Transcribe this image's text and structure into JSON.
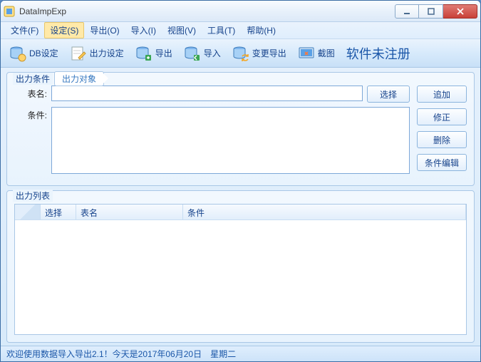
{
  "window": {
    "title": "DataImpExp"
  },
  "menu": {
    "items": [
      {
        "label": "文件(F)"
      },
      {
        "label": "设定(S)",
        "active": true
      },
      {
        "label": "导出(O)"
      },
      {
        "label": "导入(I)"
      },
      {
        "label": "视图(V)"
      },
      {
        "label": "工具(T)"
      },
      {
        "label": "帮助(H)"
      }
    ]
  },
  "toolbar": {
    "items": [
      {
        "label": "DB设定",
        "icon": "db-gear"
      },
      {
        "label": "出力设定",
        "icon": "sheet-pencil"
      },
      {
        "label": "导出",
        "icon": "db-export"
      },
      {
        "label": "导入",
        "icon": "db-import"
      },
      {
        "label": "变更导出",
        "icon": "db-change"
      },
      {
        "label": "截图",
        "icon": "screenshot"
      }
    ],
    "unregistered": "软件未注册"
  },
  "group1": {
    "title": "出力条件",
    "tab": "出力对象",
    "table_label": "表名:",
    "table_value": "",
    "cond_label": "条件:",
    "cond_value": "",
    "select_btn": "选择",
    "add_btn": "追加",
    "edit_btn": "修正",
    "delete_btn": "删除",
    "cond_edit_btn": "条件编辑"
  },
  "group2": {
    "title": "出力列表",
    "cols": {
      "select": "选择",
      "table": "表名",
      "cond": "条件"
    }
  },
  "status": {
    "text": "欢迎使用数据导入导出2.1！今天是2017年06月20日　星期二"
  }
}
